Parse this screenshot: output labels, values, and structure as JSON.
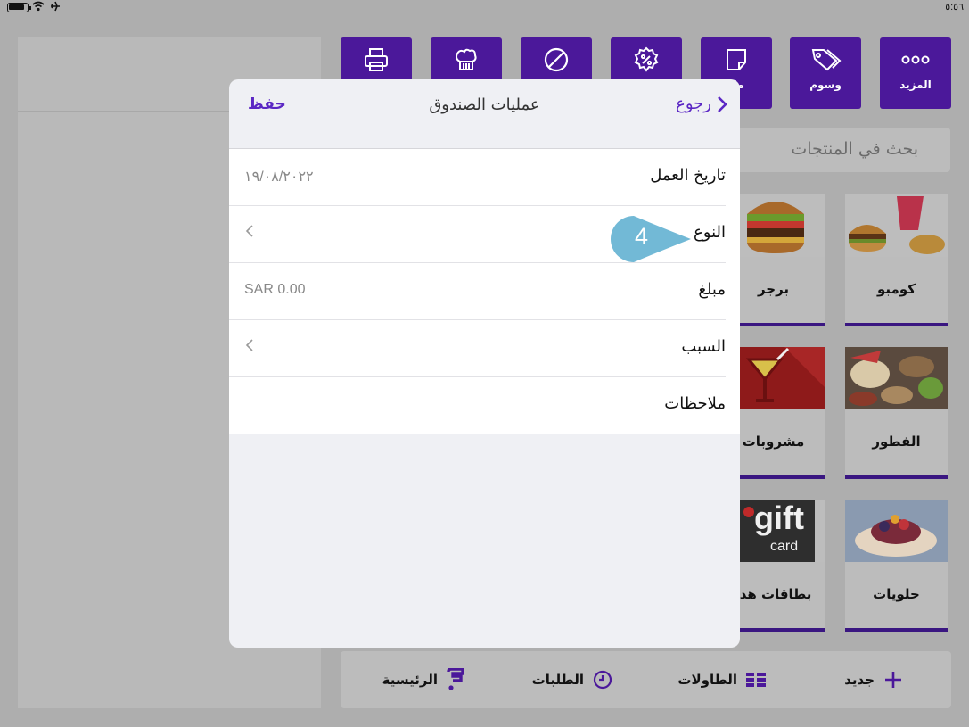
{
  "status_bar": {
    "time": "٥:٥٦"
  },
  "toolbar": {
    "items": [
      {
        "label": "",
        "icon": "printer-icon"
      },
      {
        "label": "",
        "icon": "chef-hat-icon"
      },
      {
        "label": "",
        "icon": "void-icon"
      },
      {
        "label": "",
        "icon": "discount-icon"
      },
      {
        "label": "ملا",
        "icon": "note-icon"
      },
      {
        "label": "وسوم",
        "icon": "tags-icon"
      },
      {
        "label": "المزيد",
        "icon": "more-icon"
      }
    ]
  },
  "search": {
    "placeholder": "بحث في المنتجات"
  },
  "categories": [
    {
      "name": "كومبو"
    },
    {
      "name": "برجر"
    },
    {
      "name": "الفطور"
    },
    {
      "name": "مشروبات"
    },
    {
      "name": "حلويات"
    },
    {
      "name": "بطاقات هدا"
    }
  ],
  "gift_card_text": {
    "line1": "gift",
    "line2": "card"
  },
  "bottom_bar": {
    "new": "جديد",
    "tables": "الطاولات",
    "orders": "الطلبات",
    "home": "الرئيسية"
  },
  "modal": {
    "title": "عمليات الصندوق",
    "back_label": "رجوع",
    "save_label": "حفظ",
    "rows": [
      {
        "label": "تاريخ العمل",
        "value": "١٩/٠٨/٢٠٢٢"
      },
      {
        "label": "النوع",
        "value": ""
      },
      {
        "label": "مبلغ",
        "value": "SAR 0.00"
      },
      {
        "label": "السبب",
        "value": ""
      },
      {
        "label": "ملاحظات",
        "value": ""
      }
    ]
  },
  "callout": {
    "number": "4"
  },
  "colors": {
    "accent": "#5b27c4",
    "toolbar": "#4b189a",
    "callout": "#72b9d6"
  }
}
